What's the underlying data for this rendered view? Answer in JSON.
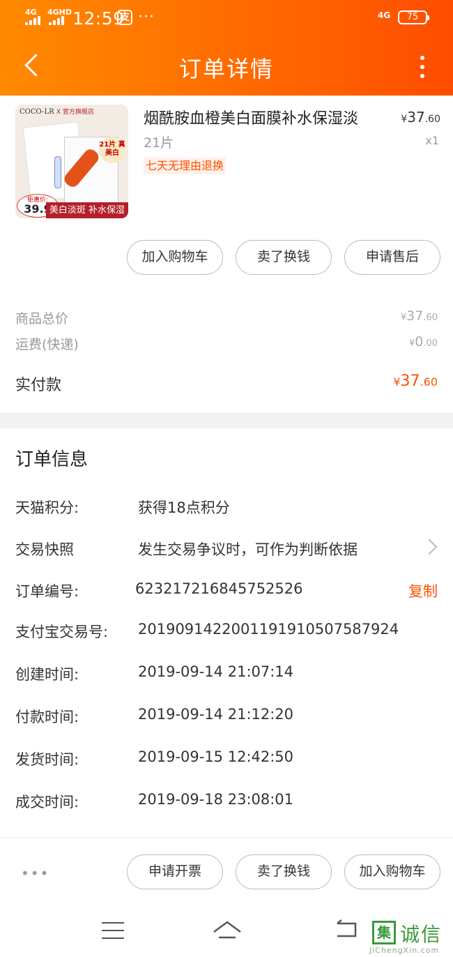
{
  "status_bar": {
    "signal1": "4G",
    "signal2": "4GHD",
    "time": "12:59",
    "app_icon": "支",
    "more": "···",
    "network": "4G",
    "battery": "75"
  },
  "header": {
    "title": "订单详情",
    "background_color": "#ff6a00"
  },
  "product": {
    "name": "烟酰胺血橙美白面膜补水保湿淡",
    "spec": "21片",
    "tag": "七天无理由退换",
    "price_currency": "¥",
    "price_int": "37",
    "price_dec": ".60",
    "qty": "x1",
    "image": {
      "brand": "COCO-LR",
      "store": "X 官方旗舰店",
      "bubble": "21片 真美白",
      "price_label": "钜惠价:",
      "price": "39.9",
      "promo": "美白淡斑 补水保湿"
    }
  },
  "product_actions": [
    "加入购物车",
    "卖了换钱",
    "申请售后"
  ],
  "summary": {
    "total_label": "商品总价",
    "total_currency": "¥",
    "total_int": "37",
    "total_dec": ".60",
    "shipping_label": "运费(快递)",
    "shipping_currency": "¥",
    "shipping_int": "0",
    "shipping_dec": ".00",
    "paid_label": "实付款",
    "paid_currency": "¥",
    "paid_int": "37",
    "paid_dec": ".60",
    "accent_color": "#ff5000"
  },
  "order_info": {
    "title": "订单信息",
    "rows": [
      {
        "label": "天猫积分:",
        "value": "获得18点积分"
      },
      {
        "label": "交易快照",
        "value": "发生交易争议时，可作为判断依据"
      },
      {
        "label": "订单编号:",
        "value": "623217216845752526",
        "action": "复制"
      },
      {
        "label": "支付宝交易号:",
        "value": "2019091422001191910507587924"
      },
      {
        "label": "创建时间:",
        "value": "2019-09-14 21:07:14"
      },
      {
        "label": "付款时间:",
        "value": "2019-09-14 21:12:20"
      },
      {
        "label": "发货时间:",
        "value": "2019-09-15 12:42:50"
      },
      {
        "label": "成交时间:",
        "value": "2019-09-18 23:08:01"
      }
    ]
  },
  "bottom_actions": {
    "more": "•••",
    "buttons": [
      "申请开票",
      "卖了换钱",
      "加入购物车"
    ]
  },
  "watermark": {
    "icon": "集",
    "text": "诚信",
    "url": "JiChengXin.com"
  }
}
